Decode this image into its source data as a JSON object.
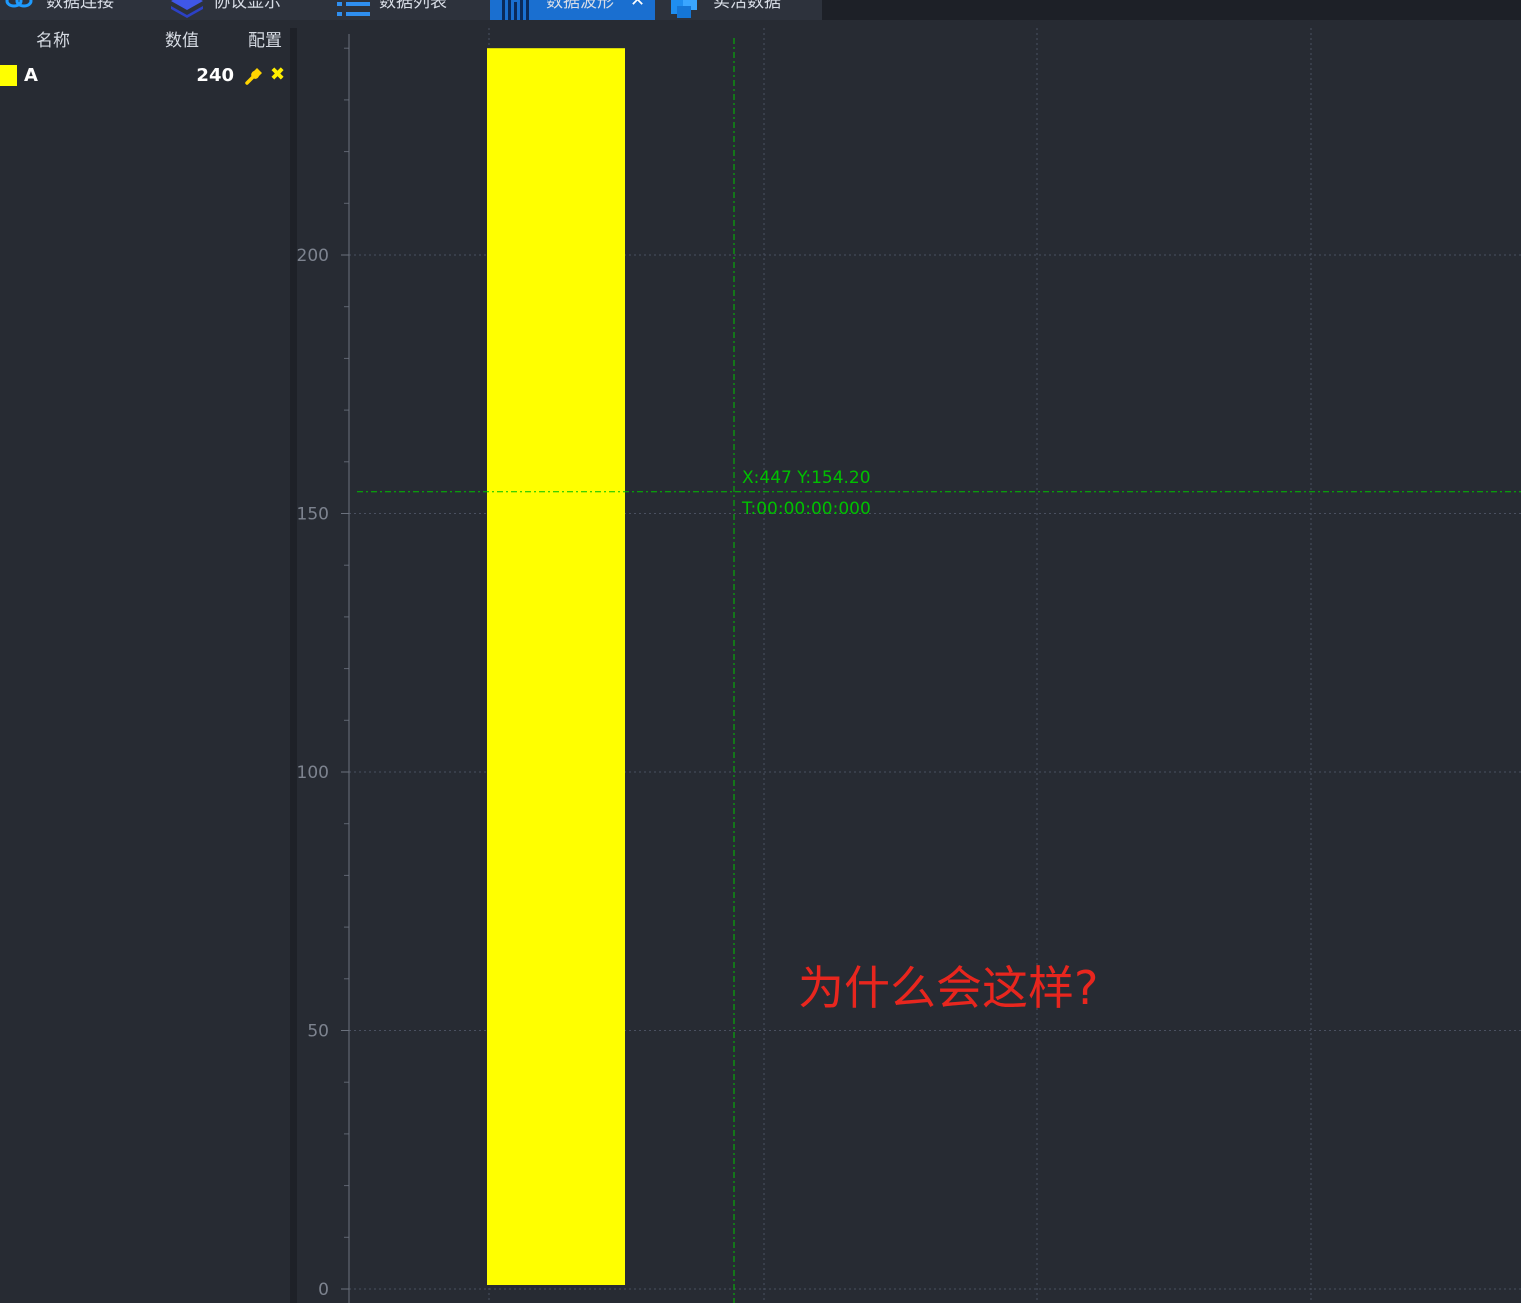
{
  "tabs": [
    {
      "label": "数据连接",
      "icon": "link-icon",
      "active": false
    },
    {
      "label": "协议显示",
      "icon": "layers-icon",
      "active": false
    },
    {
      "label": "数据列表",
      "icon": "list-icon",
      "active": false
    },
    {
      "label": "数据波形",
      "icon": "waveform-icon",
      "active": true
    },
    {
      "label": "实活数据",
      "icon": "cube-icon",
      "active": false
    }
  ],
  "channel_table": {
    "headers": {
      "name": "名称",
      "value": "数值",
      "config": "配置"
    },
    "rows": [
      {
        "name": "A",
        "value": "240",
        "color": "#ffff00"
      }
    ]
  },
  "cursor": {
    "xy_readout": "X:447 Y:154.20",
    "time_readout": "T:00:00:00:000",
    "color": "#00c000"
  },
  "annotation": {
    "text": "为什么会这样?",
    "color": "#e8261e"
  },
  "chart_data": {
    "type": "area",
    "y_ticks": [
      "0",
      "50",
      "100",
      "150",
      "200"
    ],
    "ylim": [
      0,
      240
    ],
    "series": [
      {
        "color": "#ffff00",
        "fill_from": 0,
        "fill_to": 240,
        "note_value": 240
      }
    ],
    "cursor_y": 154.2,
    "grid": true
  }
}
